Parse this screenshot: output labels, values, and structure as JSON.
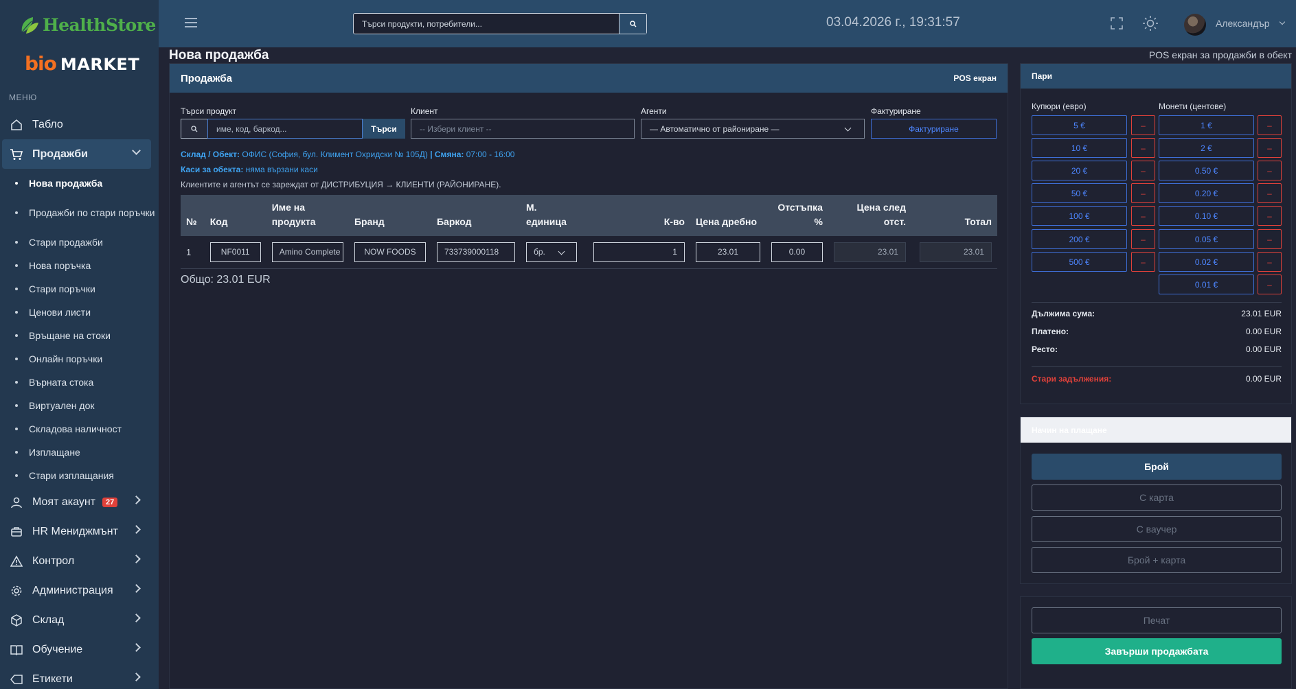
{
  "brand": {
    "logo_text_1": "HealthStore",
    "logo_bio": "bio",
    "logo_market": "MARKET"
  },
  "sidebar": {
    "heading": "МЕНЮ",
    "items": [
      {
        "label": "Табло",
        "icon": "home-icon"
      },
      {
        "label": "Продажби",
        "icon": "cart-icon"
      },
      {
        "label": "Моят акаунт",
        "icon": "user-icon",
        "badge": "27"
      },
      {
        "label": "HR Мениджмънт",
        "icon": "briefcase-icon"
      },
      {
        "label": "Контрол",
        "icon": "warning-icon"
      },
      {
        "label": "Администрация",
        "icon": "gear-icon"
      },
      {
        "label": "Склад",
        "icon": "box-icon"
      },
      {
        "label": "Обучение",
        "icon": "book-icon"
      },
      {
        "label": "Етикети",
        "icon": "tag-icon"
      }
    ],
    "sub_items": [
      "Нова продажба",
      "Продажби по стари поръчки",
      "Стари продажби",
      "Нова поръчка",
      "Стари поръчки",
      "Ценови листи",
      "Връщане на стоки",
      "Онлайн поръчки",
      "Върната стока",
      "Виртуален док",
      "Складова наличност",
      "Изплащане",
      "Стари изплащания"
    ]
  },
  "topbar": {
    "search_placeholder": "Търси продукти, потребители...",
    "datetime": "03.04.2026 г., 19:31:57",
    "user_name": "Александър"
  },
  "page": {
    "title": "Нова продажба",
    "subtitle": "POS екран за продажби в обект"
  },
  "sale": {
    "card_title": "Продажба",
    "card_right": "POS екран",
    "search_label": "Търси продукт",
    "search_placeholder": "име, код, баркод...",
    "search_button": "Търси",
    "client_label": "Клиент",
    "client_placeholder": "-- Избери клиент --",
    "agents_label": "Агенти",
    "agents_value": "— Автоматично от райониране —",
    "invoice_label": "Фактуриране",
    "invoice_button": "Фактуриране",
    "warehouse_key": "Склад / Обект:",
    "warehouse_value": "ОФИС (София, бул. Климент Охридски № 105Д)",
    "shift_key": "| Смяна:",
    "shift_value": "07:00 - 16:00",
    "cash_key": "Каси за обекта:",
    "cash_value": "няма вързани каси",
    "note": "Клиентите и агентът се зареждат от ДИСТРИБУЦИЯ → КЛИЕНТИ (РАЙОНИРАНЕ).",
    "columns": [
      "№",
      "Код",
      "Име на продукта",
      "Бранд",
      "Баркод",
      "М. единица",
      "К-во",
      "Цена дребно",
      "Отстъпка %",
      "Цена след отст.",
      "Тотал"
    ],
    "rows": [
      {
        "n": "1",
        "code": "NF0011",
        "name": "Amino Complete",
        "brand": "NOW FOODS",
        "barcode": "733739000118",
        "unit": "бр.",
        "qty": "1",
        "price": "23.01",
        "discount": "0.00",
        "net": "23.01",
        "total": "23.01"
      }
    ],
    "grand_total": "Общо: 23.01 EUR"
  },
  "money": {
    "title": "Пари",
    "bills_label": "Купюри (евро)",
    "coins_label": "Монети (центове)",
    "bills": [
      "5 €",
      "10 €",
      "20 €",
      "50 €",
      "100 €",
      "200 €",
      "500 €"
    ],
    "coins": [
      "1 €",
      "2 €",
      "0.50 €",
      "0.20 €",
      "0.10 €",
      "0.05 €",
      "0.02 €",
      "0.01 €"
    ],
    "minus": "–",
    "due_label": "Дължима сума:",
    "due_value": "23.01 EUR",
    "paid_label": "Платено:",
    "paid_value": "0.00 EUR",
    "change_label": "Ресто:",
    "change_value": "0.00 EUR",
    "old_debts_label": "Стари задължения:",
    "old_debts_value": "0.00 EUR"
  },
  "payment": {
    "title": "Начин на плащане",
    "methods": [
      "Брой",
      "С карта",
      "С ваучер",
      "Брой + карта"
    ],
    "selected": "Брой"
  },
  "actions": {
    "print": "Печат",
    "finish": "Завърши продажбата"
  },
  "colors": {
    "sidebar": "#23384f",
    "topbar": "#2a4b6a",
    "accent_blue": "#4d86ff",
    "danger": "#e0413a",
    "success": "#1fb08a"
  }
}
